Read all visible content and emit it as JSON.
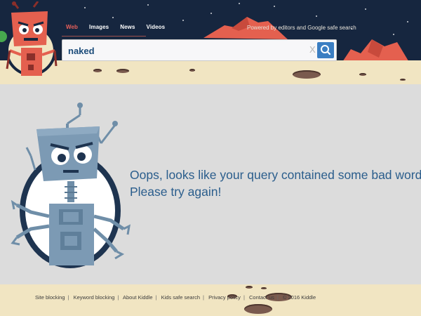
{
  "nav": {
    "tabs": [
      {
        "label": "Web",
        "active": true
      },
      {
        "label": "Images",
        "active": false
      },
      {
        "label": "News",
        "active": false
      },
      {
        "label": "Videos",
        "active": false
      }
    ],
    "powered_by": "Powered by editors and Google safe search"
  },
  "search": {
    "value": "naked",
    "clear_label": "X",
    "button_icon": "search-icon"
  },
  "main": {
    "message_line1": "Oops, looks like your query contained some bad words.",
    "message_line2": "Please try again!"
  },
  "footer": {
    "links": [
      "Site blocking",
      "Keyword blocking",
      "About Kiddle",
      "Kids safe search",
      "Privacy policy",
      "Contact us"
    ],
    "copyright": "© 2016 Kiddle"
  },
  "colors": {
    "header_bg": "#16263f",
    "active_tab": "#e8605a",
    "search_button": "#3b7ec2",
    "message_text": "#2a5d8c",
    "sand": "#f1e5c2"
  }
}
